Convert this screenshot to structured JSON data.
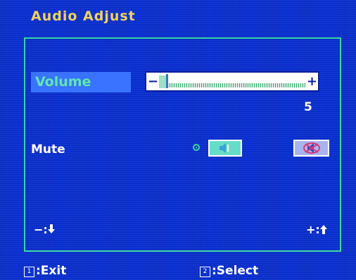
{
  "title": "Audio Adjust",
  "volume": {
    "label": "Volume",
    "value": "5",
    "level_fraction": 0.05,
    "minus_symbol": "−",
    "plus_symbol": "+"
  },
  "mute": {
    "label": "Mute",
    "selected": "speaker-on",
    "on_icon": "speaker-icon",
    "off_icon": "speaker-muted-icon"
  },
  "hints": {
    "left": "−:",
    "left_icon": "arrow-down-icon",
    "right": "+:",
    "right_icon": "arrow-up-icon"
  },
  "footer": {
    "exit_key": "1",
    "exit_label": ":Exit",
    "select_key": "2",
    "select_label": ":Select"
  },
  "colors": {
    "background": "#0a2fd0",
    "title": "#f2d35a",
    "frame": "#39d6a0",
    "highlight": "#3a73ff",
    "highlight_text": "#5ee7ad"
  }
}
